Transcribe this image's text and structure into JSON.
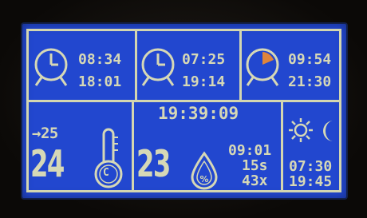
{
  "alarms": [
    {
      "icon": "alarm-clock-icon",
      "time1": "08:34",
      "time2": "18:01"
    },
    {
      "icon": "alarm-clock-icon",
      "time1": "07:25",
      "time2": "19:14"
    },
    {
      "icon": "timer-clock-icon",
      "time1": "09:54",
      "time2": "21:30"
    }
  ],
  "temperature": {
    "target": "→25",
    "current": "24",
    "unit": "C",
    "icon": "thermometer-icon"
  },
  "center": {
    "clock": "19:39:09",
    "humidity": "23",
    "drop_icon": "water-drop-icon",
    "time": "09:01",
    "seconds": "15s",
    "count": "43x"
  },
  "daynight": {
    "sun_icon": "sun-icon",
    "moon_icon": "moon-icon",
    "sunrise": "07:30",
    "sunset": "19:45"
  },
  "colors": {
    "background": "#2247cf",
    "foreground": "#d6d8b6",
    "accent": "#e0853a"
  }
}
